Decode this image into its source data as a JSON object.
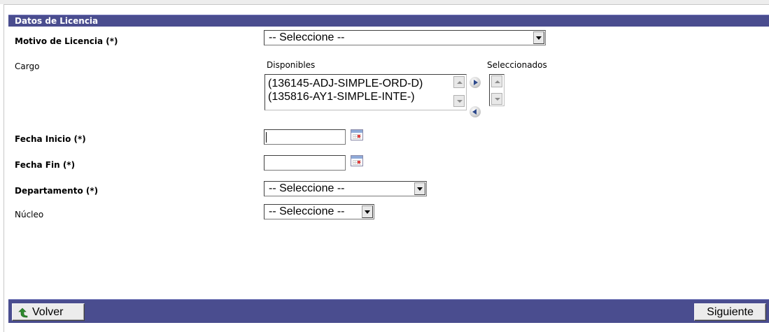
{
  "section": {
    "title": "Datos de Licencia"
  },
  "form": {
    "motivo": {
      "label": "Motivo de Licencia (*)",
      "value": "-- Seleccione --"
    },
    "cargo": {
      "label": "Cargo",
      "available_label": "Disponibles",
      "selected_label": "Seleccionados",
      "available_items": [
        "(136145-ADJ-SIMPLE-ORD-D)",
        "(135816-AY1-SIMPLE-INTE-)"
      ]
    },
    "fecha_inicio": {
      "label": "Fecha Inicio (*)",
      "value": ""
    },
    "fecha_fin": {
      "label": "Fecha Fin (*)",
      "value": ""
    },
    "departamento": {
      "label": "Departamento (*)",
      "value": "-- Seleccione --"
    },
    "nucleo": {
      "label": "Núcleo",
      "value": "-- Seleccione --"
    }
  },
  "footer": {
    "back_label": "Volver",
    "next_label": "Siguiente"
  },
  "colors": {
    "header_bg": "#4a4d8f",
    "footer_bg": "#4a4d8f",
    "back_arrow": "#2e8b2e"
  }
}
